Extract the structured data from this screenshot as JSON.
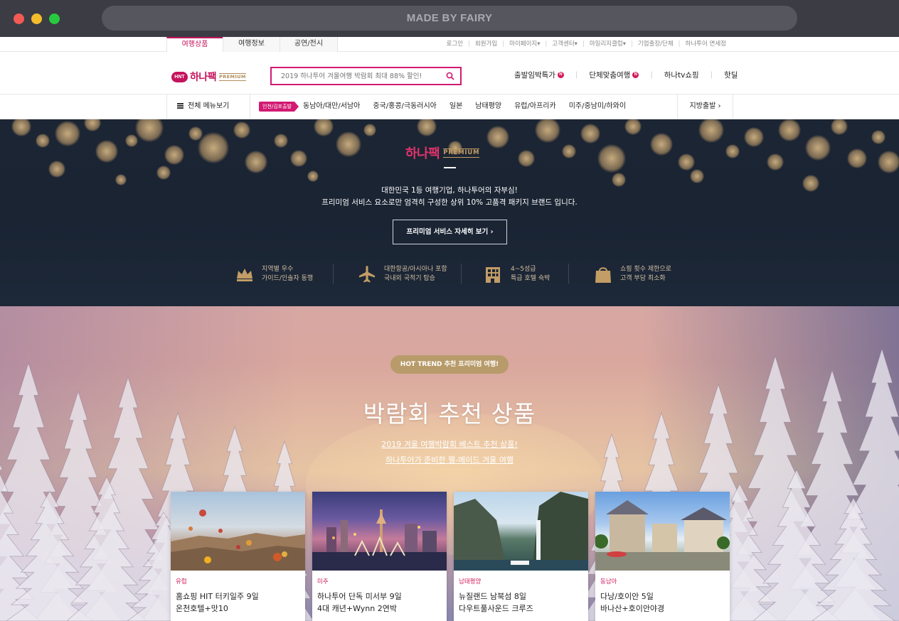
{
  "browser": {
    "url_title": "MADE BY FAIRY"
  },
  "util": {
    "tabs": [
      "여행상품",
      "여행정보",
      "공연/전시"
    ],
    "links": [
      "로그인",
      "회원가입",
      "마이페이지▾",
      "고객센터▾",
      "마일리지클럽▾",
      "기업출장/단체",
      "하나투어 면세점"
    ]
  },
  "header": {
    "logo_badge": "HNT",
    "logo_text": "하나팩",
    "logo_premium": "PREMIUM",
    "search_placeholder": "2019 하나투어 겨울여행 박람회 최대 88% 할인!",
    "links": [
      "출발임박특가",
      "단체맞춤여행",
      "하나tv쇼핑",
      "핫딜"
    ],
    "new_badge": "N"
  },
  "gnb": {
    "all_menu": "전체 메뉴보기",
    "departure_pill": "인천/김포출발",
    "items": [
      "동남아/대만/서남아",
      "중국/홍콩/극동러시아",
      "일본",
      "남태평양",
      "유럽/아프리카",
      "미주/중남미/하와이"
    ],
    "local_departure": "지방출발"
  },
  "hero1": {
    "logo_text": "하나팩",
    "logo_premium": "PREMIUM",
    "desc_line1": "대한민국 1등 여행기업, 하나투어의 자부심!",
    "desc_line2": "프리미엄 서비스 요소로만 엄격히 구성한 상위 10% 고품격 패키지 브랜드 입니다.",
    "button": "프리미엄 서비스 자세히 보기",
    "features": [
      {
        "icon": "crown-icon",
        "line1": "지역별 우수",
        "line2": "가이드/인솔자 동행"
      },
      {
        "icon": "airplane-icon",
        "line1": "대한항공/아시아나 포함",
        "line2": "국내외 국적기 탑승"
      },
      {
        "icon": "building-icon",
        "line1": "4~5성급",
        "line2": "특급 호텔 숙박"
      },
      {
        "icon": "shopping-bag-icon",
        "line1": "쇼핑 횟수 제한으로",
        "line2": "고객 부담 최소화"
      }
    ],
    "accent": "#c29d66"
  },
  "hero2": {
    "pill": "HOT TREND 추천 프리미엄 여행!",
    "title": "박람회 추천 상품",
    "sub1": "2019 겨울 여행박람회 베스트 추천 상품!",
    "sub2": "하나투어가 준비한 웰-메이드 겨울 여행"
  },
  "cards": [
    {
      "category": "유럽",
      "name1": "홈쇼핑 HIT 터키일주 9일",
      "name2": "온천호텔+맛10"
    },
    {
      "category": "미주",
      "name1": "하나투어 단독 미서부 9일",
      "name2": "4대 캐년+Wynn 2연박"
    },
    {
      "category": "남태평양",
      "name1": "뉴질랜드 남북섬 8일",
      "name2": "다우트풀사운드 크루즈"
    },
    {
      "category": "동남아",
      "name1": "다낭/호이안 5일",
      "name2": "바나산+호이안야경"
    }
  ],
  "colors": {
    "brand": "#c4135c",
    "search_border": "#d21a72",
    "gold": "#b89b6a"
  }
}
